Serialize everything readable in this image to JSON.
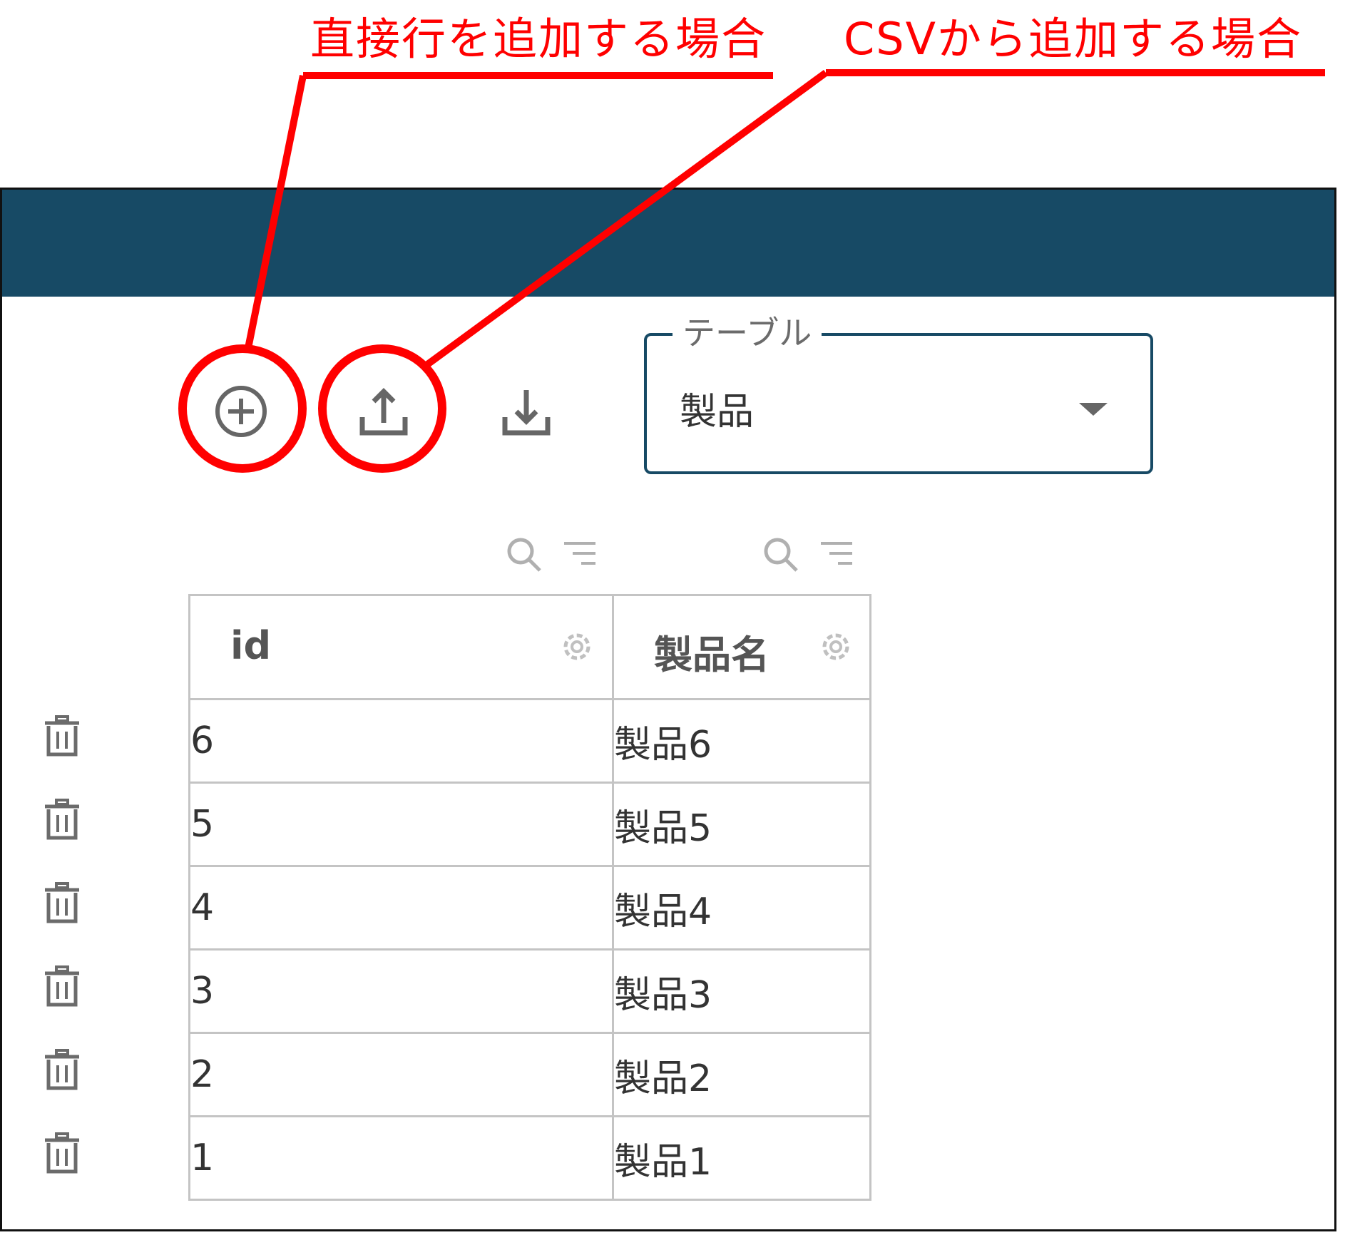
{
  "annotations": {
    "add_row_callout": "直接行を追加する場合",
    "add_csv_callout": "CSVから追加する場合",
    "highlight_color": "#ff0000"
  },
  "header": {
    "color": "#174a65"
  },
  "toolbar": {
    "add_icon": "add-circle-icon",
    "upload_icon": "upload-icon",
    "download_icon": "download-icon"
  },
  "table_select": {
    "legend": "テーブル",
    "value": "製品"
  },
  "table": {
    "columns": [
      "id",
      "製品名"
    ],
    "rows": [
      {
        "id": "6",
        "name": "製品6"
      },
      {
        "id": "5",
        "name": "製品5"
      },
      {
        "id": "4",
        "name": "製品4"
      },
      {
        "id": "3",
        "name": "製品3"
      },
      {
        "id": "2",
        "name": "製品2"
      },
      {
        "id": "1",
        "name": "製品1"
      }
    ]
  }
}
